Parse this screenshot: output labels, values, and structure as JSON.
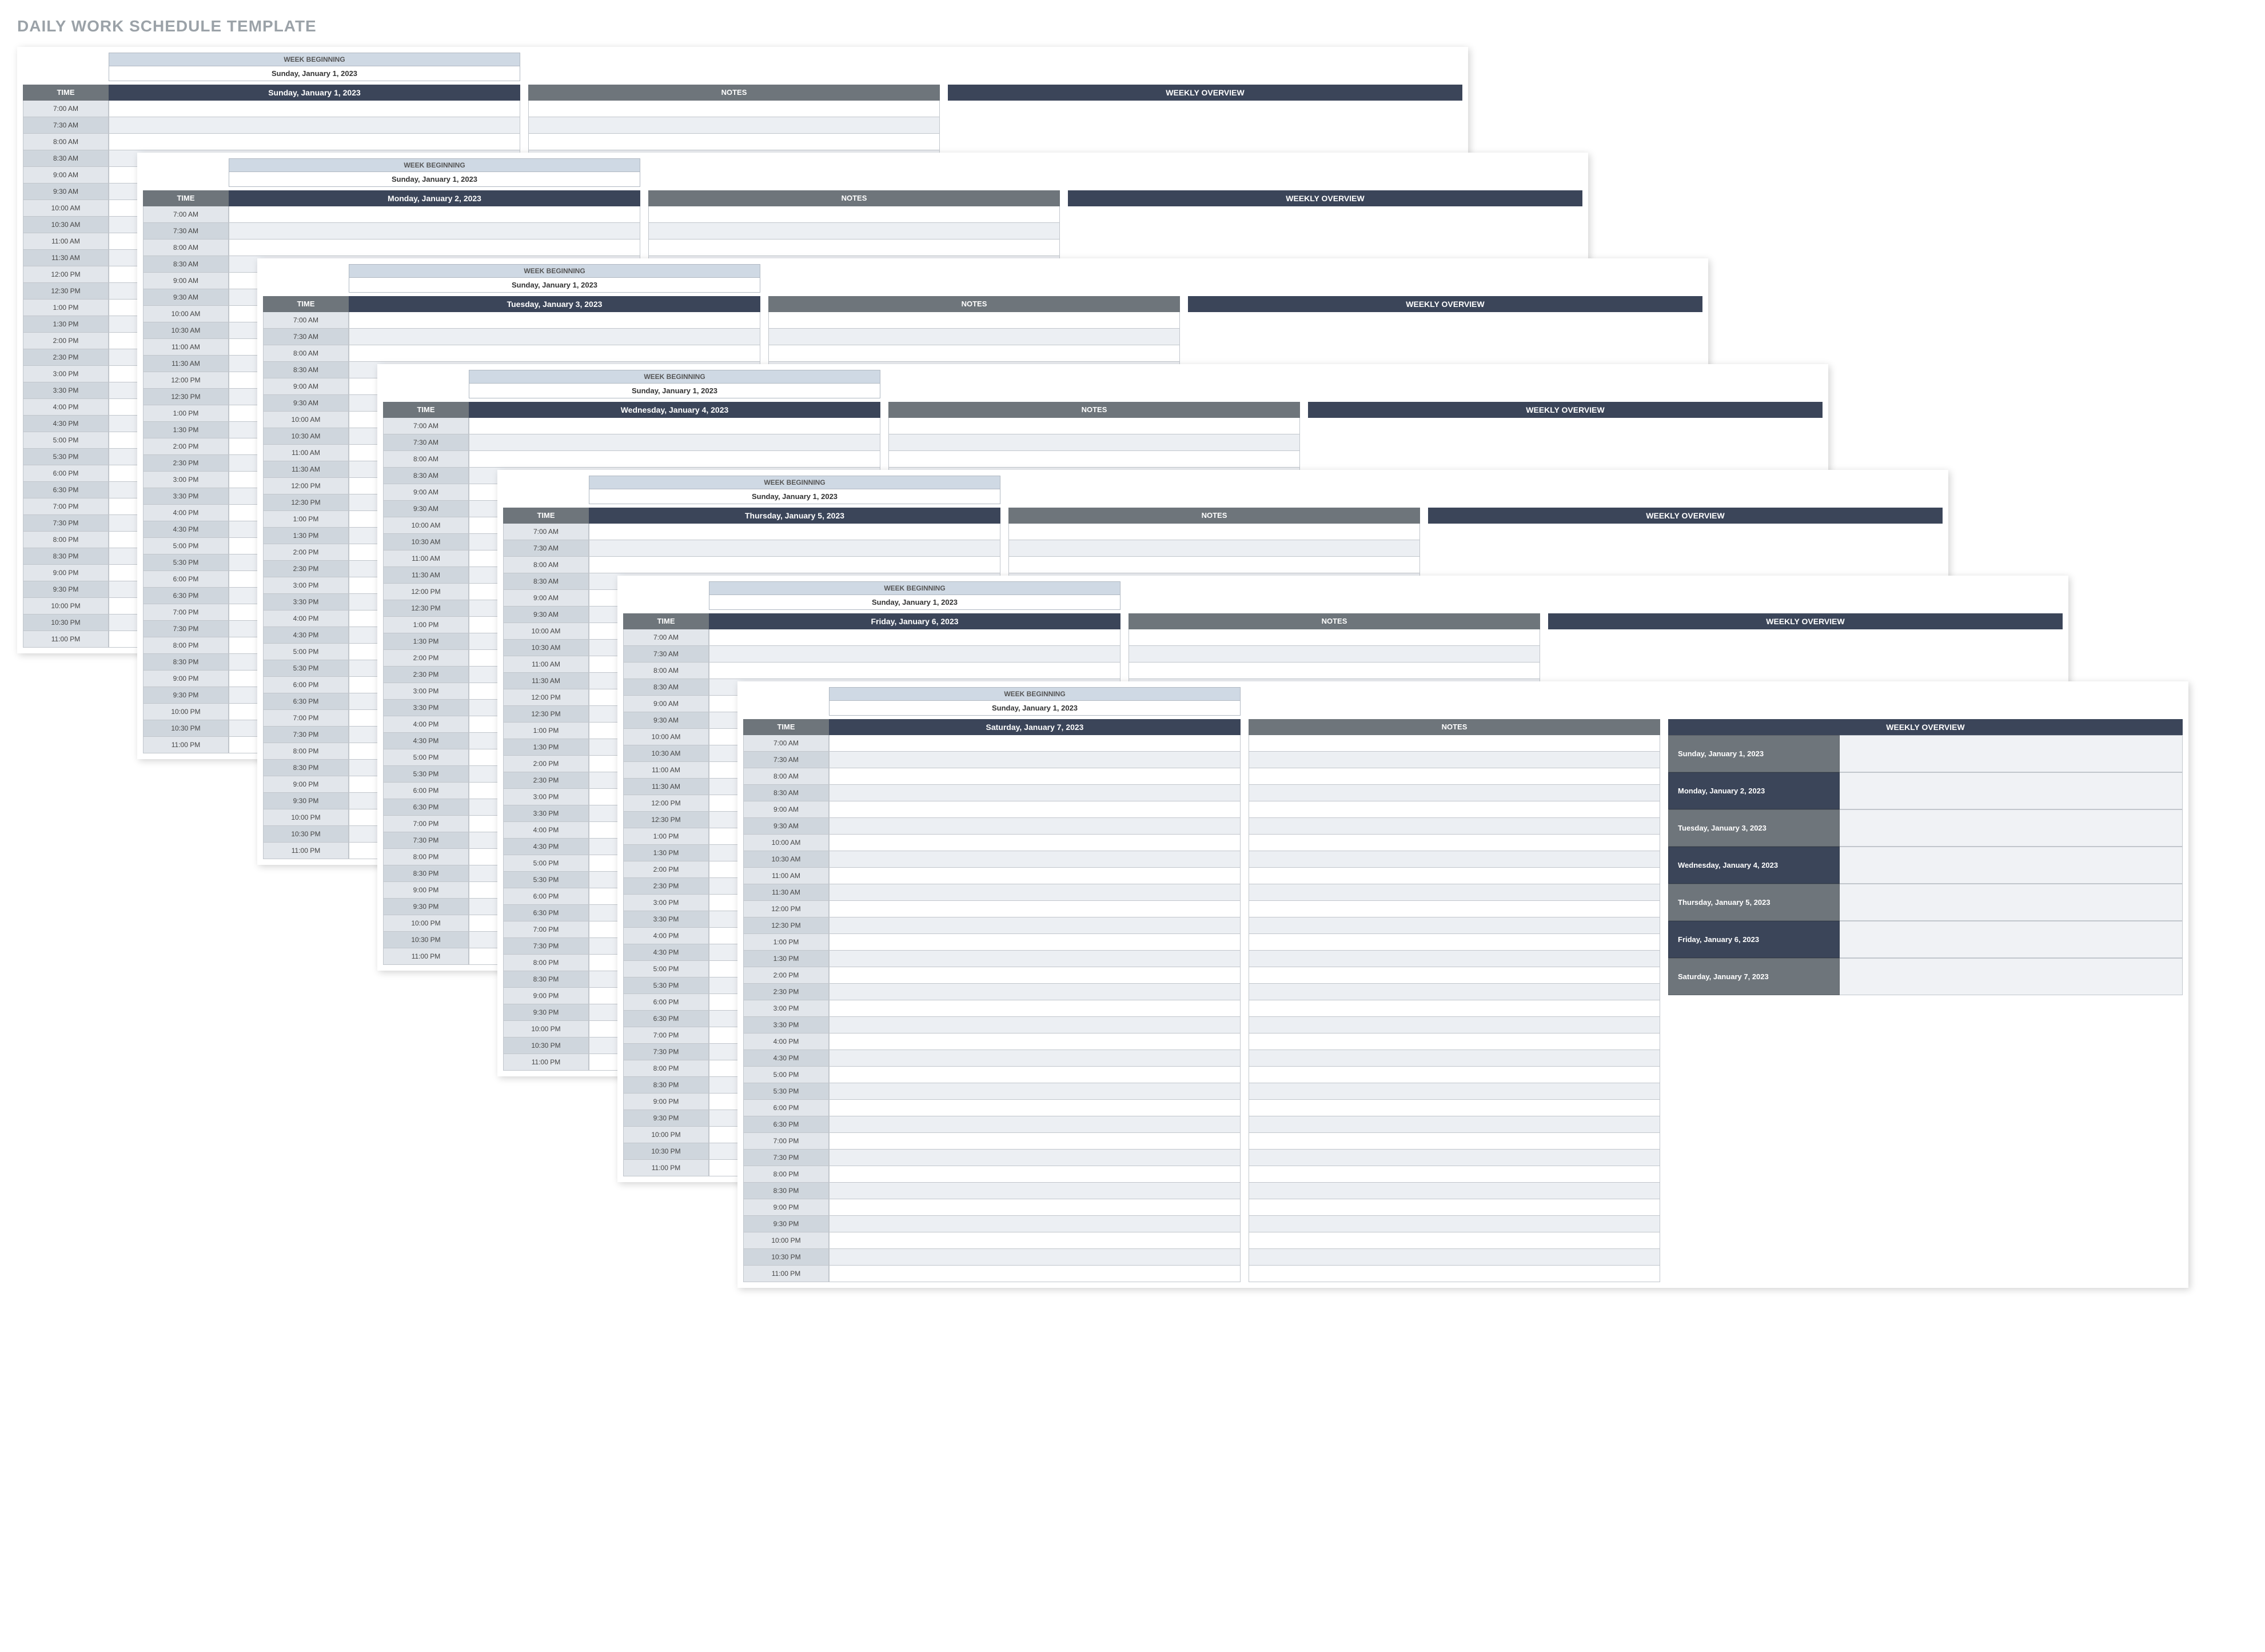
{
  "title": "DAILY WORK SCHEDULE TEMPLATE",
  "week_beginning_label": "WEEK BEGINNING",
  "week_beginning_value": "Sunday, January 1, 2023",
  "time_header": "TIME",
  "notes_header": "NOTES",
  "overview_header": "WEEKLY OVERVIEW",
  "time_slots": [
    "7:00 AM",
    "7:30 AM",
    "8:00 AM",
    "8:30 AM",
    "9:00 AM",
    "9:30 AM",
    "10:00 AM",
    "10:30 AM",
    "11:00 AM",
    "11:30 AM",
    "12:00 PM",
    "12:30 PM",
    "1:00 PM",
    "1:30 PM",
    "2:00 PM",
    "2:30 PM",
    "3:00 PM",
    "3:30 PM",
    "4:00 PM",
    "4:30 PM",
    "5:00 PM",
    "5:30 PM",
    "6:00 PM",
    "6:30 PM",
    "7:00 PM",
    "7:30 PM",
    "8:00 PM",
    "8:30 PM",
    "9:00 PM",
    "9:30 PM",
    "10:00 PM",
    "10:30 PM",
    "11:00 PM"
  ],
  "sheets": [
    {
      "day": "Sunday, January 1, 2023"
    },
    {
      "day": "Monday, January 2, 2023"
    },
    {
      "day": "Tuesday, January 3, 2023"
    },
    {
      "day": "Wednesday, January 4, 2023"
    },
    {
      "day": "Thursday, January 5, 2023"
    },
    {
      "day": "Friday, January 6, 2023"
    },
    {
      "day": "Saturday, January 7, 2023"
    }
  ],
  "weekly_overview_days": [
    "Sunday, January 1, 2023",
    "Monday, January 2, 2023",
    "Tuesday, January 3, 2023",
    "Wednesday, January 4, 2023",
    "Thursday, January 5, 2023",
    "Friday, January 6, 2023",
    "Saturday, January 7, 2023"
  ]
}
